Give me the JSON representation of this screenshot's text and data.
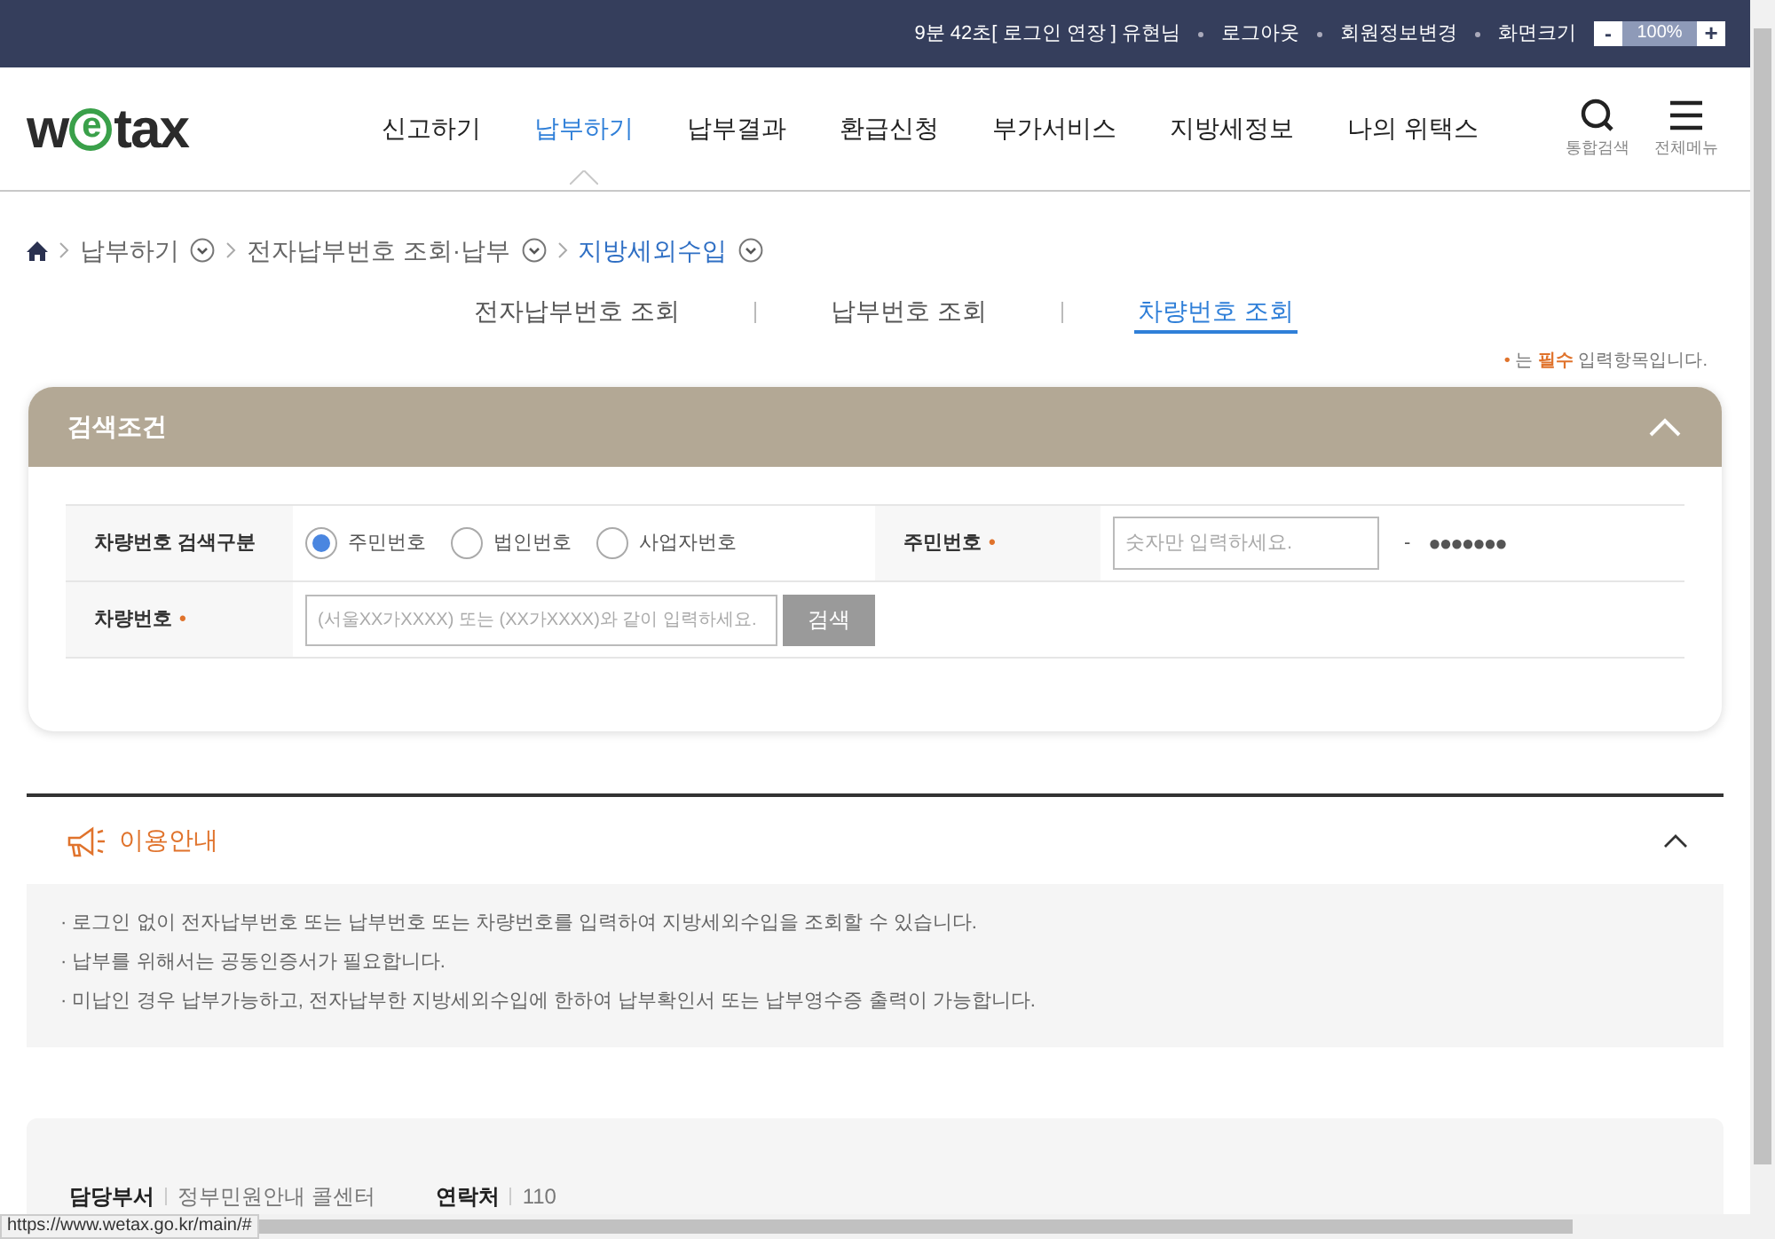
{
  "top_bar": {
    "session_text": "9분 42초[ 로그인 연장 ] 유현님",
    "links": [
      "로그아웃",
      "회원정보변경"
    ],
    "zoom_label": "화면크기",
    "zoom_minus": "-",
    "zoom_value": "100%",
    "zoom_plus": "+"
  },
  "logo": {
    "text": "wetax"
  },
  "nav": {
    "items": [
      {
        "label": "신고하기",
        "selected": false
      },
      {
        "label": "납부하기",
        "selected": true
      },
      {
        "label": "납부결과",
        "selected": false
      },
      {
        "label": "환급신청",
        "selected": false
      },
      {
        "label": "부가서비스",
        "selected": false
      },
      {
        "label": "지방세정보",
        "selected": false
      },
      {
        "label": "나의 위택스",
        "selected": false
      }
    ],
    "utilities": [
      {
        "label": "통합검색",
        "kind": "search"
      },
      {
        "label": "전체메뉴",
        "kind": "menu"
      }
    ]
  },
  "breadcrumb": [
    {
      "label": "납부하기",
      "current": false
    },
    {
      "label": "전자납부번호 조회·납부",
      "current": false
    },
    {
      "label": "지방세외수입",
      "current": true
    }
  ],
  "tabs": [
    {
      "label": "전자납부번호 조회",
      "selected": false
    },
    {
      "label": "납부번호 조회",
      "selected": false
    },
    {
      "label": "차량번호 조회",
      "selected": true
    }
  ],
  "required_note": {
    "mark": "•",
    "text": "는 **필수** 입력항목입니다."
  },
  "search_panel": {
    "title": "검색조건",
    "expanded": true,
    "search_type": {
      "label": "차량번호 검색구분",
      "options": [
        {
          "label": "주민번호",
          "selected": true
        },
        {
          "label": "법인번호",
          "selected": false
        },
        {
          "label": "사업자번호",
          "selected": false
        }
      ]
    },
    "id_number": {
      "label": "주민번호",
      "required": true,
      "required_mark": "•",
      "placeholder": "숫자만 입력하세요.",
      "separator": "-",
      "masked": "●●●●●●●"
    },
    "plate_number": {
      "label": "차량번호",
      "required": true,
      "required_mark": "•",
      "placeholder": "(서울XX가XXXX) 또는 (XX가XXXX)와 같이 입력하세요.",
      "button": "검색"
    }
  },
  "guide": {
    "title": "이용안내",
    "expanded": true,
    "items": [
      "· 로그인 없이 전자납부번호 또는 납부번호 또는 차량번호를 입력하여 지방세외수입을 조회할 수 있습니다.",
      "· 납부를 위해서는 공동인증서가 필요합니다.",
      "· 미납인 경우 납부가능하고, 전자납부한 지방세외수입에 한하여 납부확인서 또는 납부영수증 출력이 가능합니다."
    ]
  },
  "contact": [
    {
      "label": "담당부서",
      "value": "정부민원안내 콜센터"
    },
    {
      "label": "연락처",
      "value": "110"
    }
  ],
  "status_url": "https://www.wetax.go.kr/main/#"
}
